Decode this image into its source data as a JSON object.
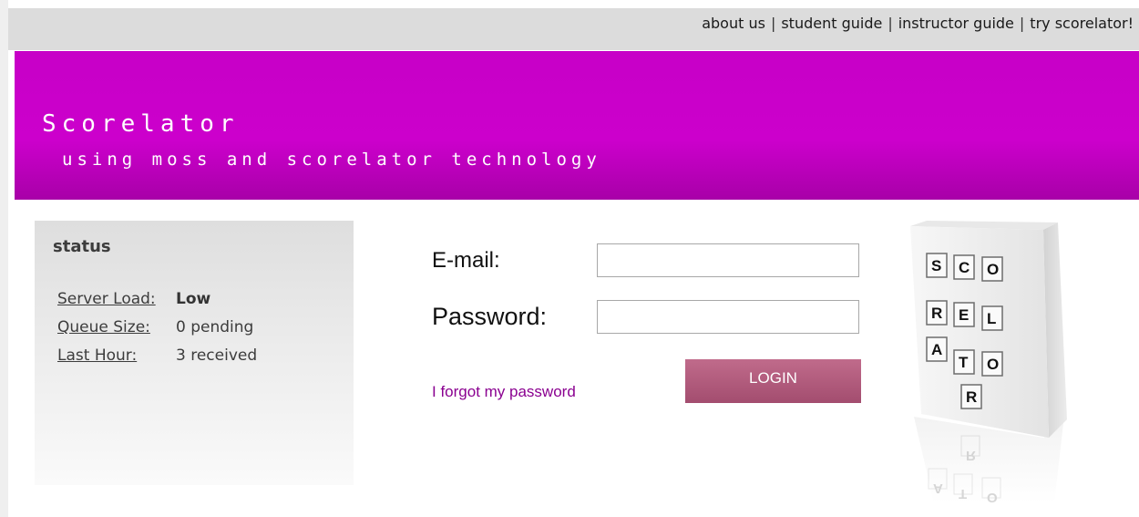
{
  "topnav": {
    "items": [
      "about us",
      "student guide",
      "instructor guide",
      "try scorelator!"
    ],
    "separator": "|"
  },
  "banner": {
    "title": "Scorelator",
    "subtitle": "using moss and scorelator technology",
    "color": "#cc00cc"
  },
  "status": {
    "title": "status",
    "rows": [
      {
        "label": "Server Load:",
        "value": "Low"
      },
      {
        "label": "Queue Size:",
        "value": "0 pending"
      },
      {
        "label": "Last Hour:",
        "value": "3 received"
      }
    ]
  },
  "login_form": {
    "email_label": "E-mail:",
    "email_value": "",
    "password_label": "Password:",
    "password_value": "",
    "forgot_link": "I forgot my password",
    "login_button": "LOGIN",
    "button_color": "#b05a7c",
    "link_color": "#8a0090"
  },
  "logo": {
    "tiles": [
      "S",
      "C",
      "O",
      "R",
      "E",
      "L",
      "A",
      "T",
      "O",
      "R"
    ],
    "reflection_tiles": [
      "R",
      "A",
      "T",
      "O"
    ]
  }
}
